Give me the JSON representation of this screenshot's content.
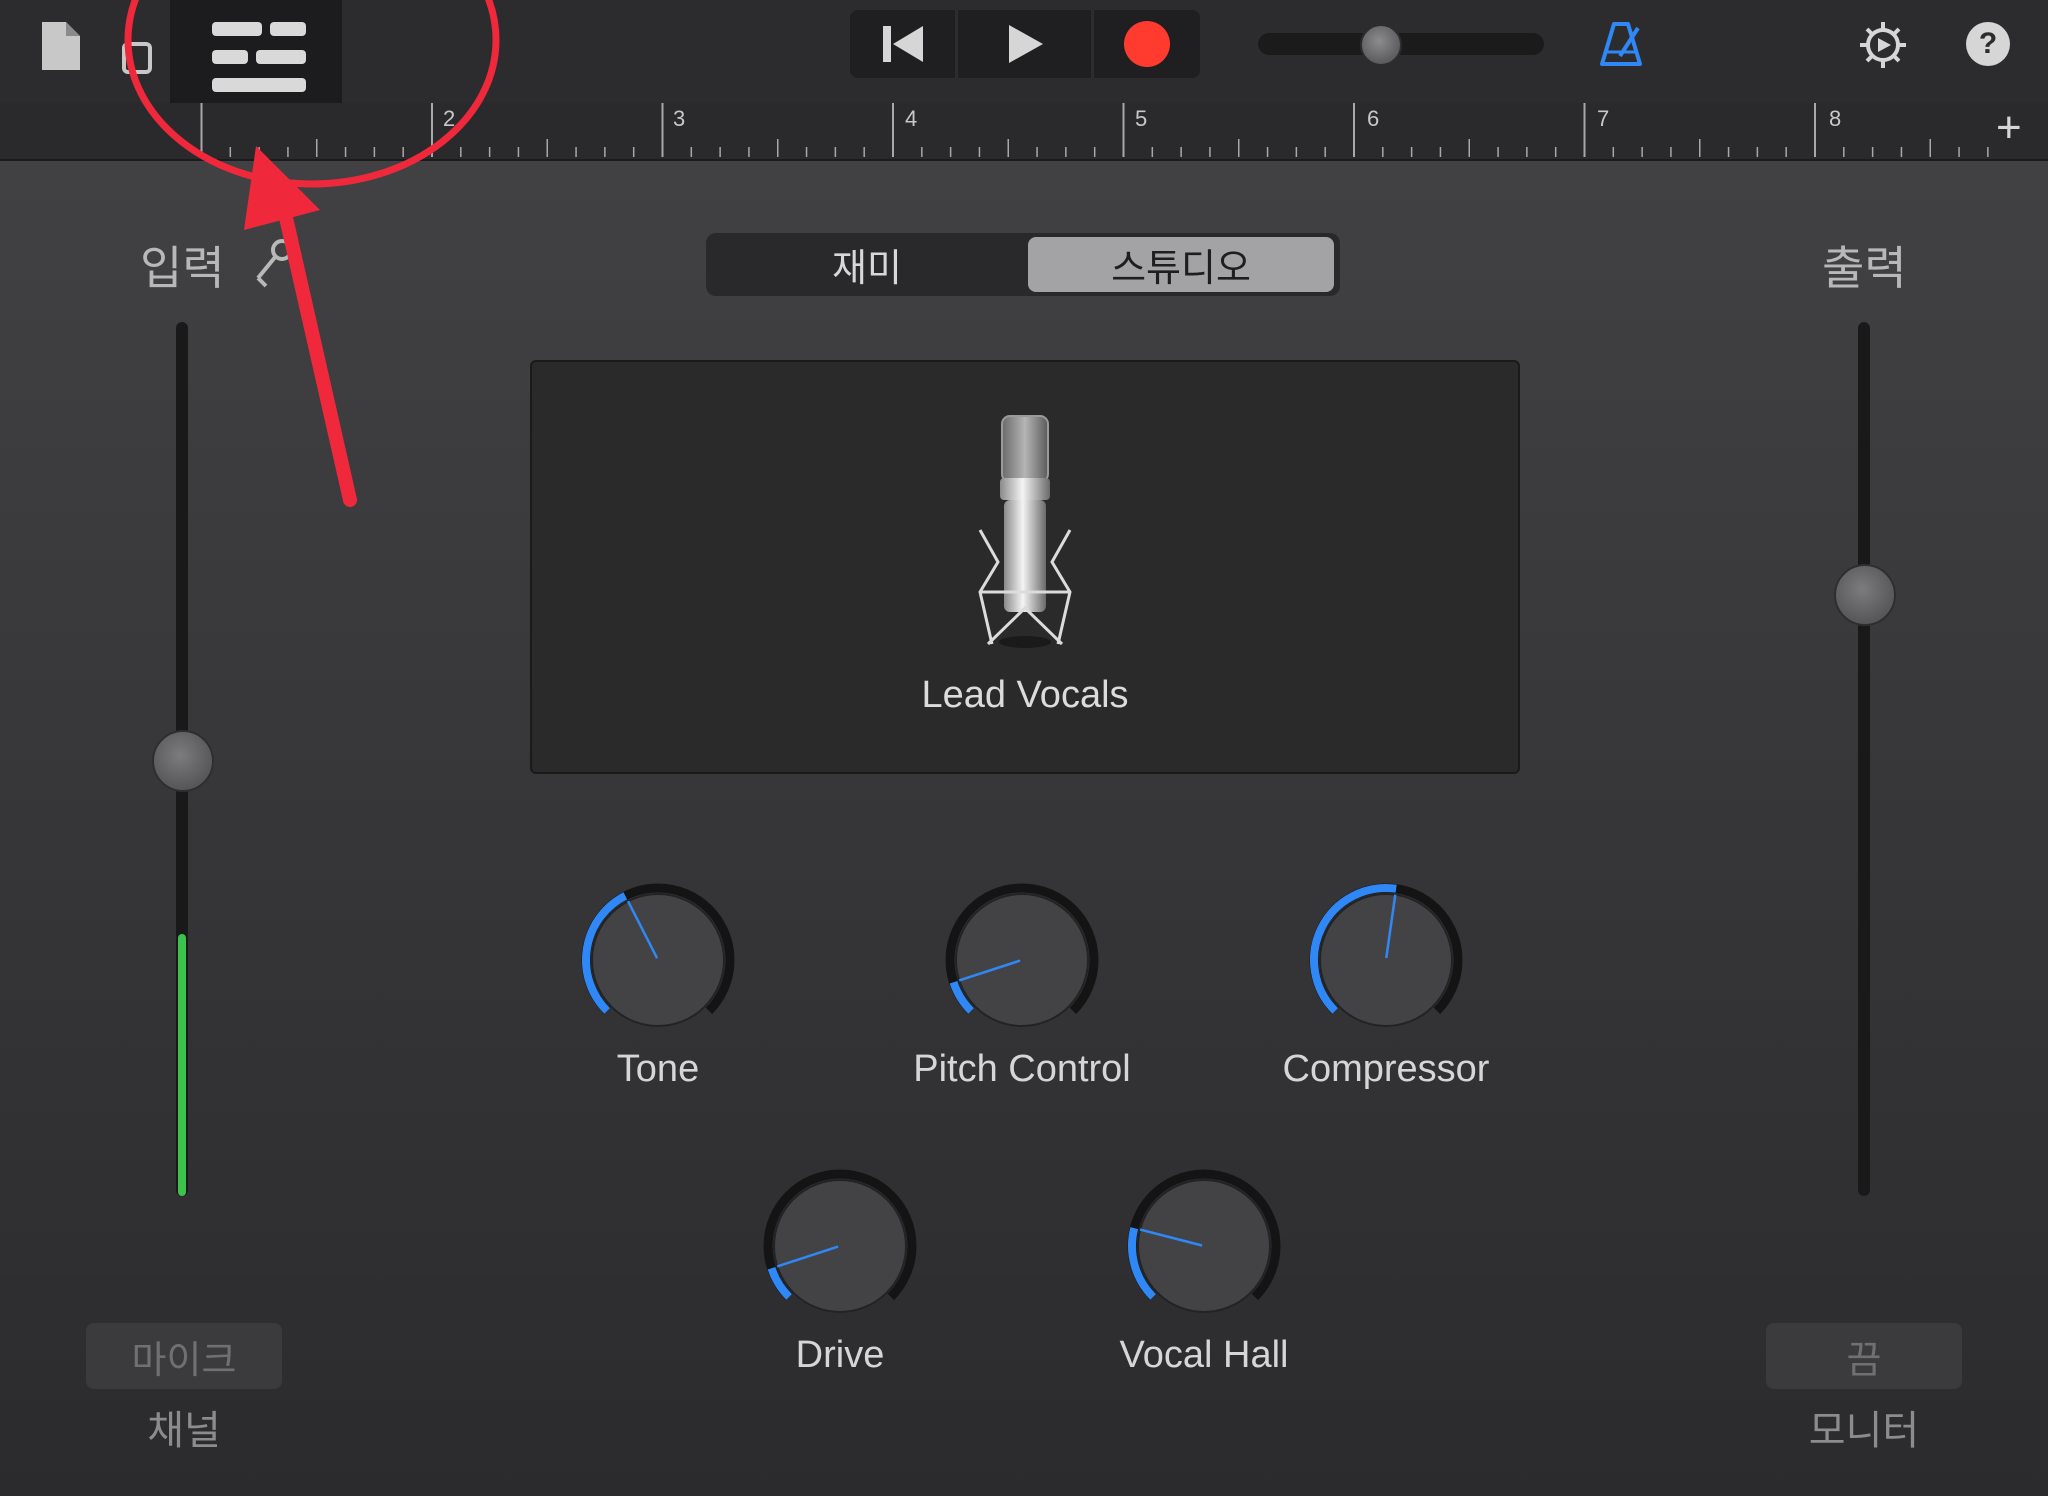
{
  "toolbar": {
    "ruler_numbers": [
      "2",
      "3",
      "4",
      "5",
      "6",
      "7",
      "8"
    ],
    "add_label": "+",
    "help_label": "?",
    "record_color": "#ff3b30",
    "accent_color": "#2f88f5",
    "master_volume": 0.42
  },
  "modes": {
    "fun_label": "재미",
    "studio_label": "스튜디오",
    "selected": "studio_label"
  },
  "input": {
    "title": "입력",
    "channel_button": "마이크",
    "channel_label": "채널",
    "level": 0.3,
    "gain": 0.5,
    "level_color": "#3ec24e"
  },
  "output": {
    "title": "출력",
    "monitor_button": "끔",
    "monitor_label": "모니터",
    "volume": 0.69
  },
  "patch": {
    "name": "Lead Vocals"
  },
  "knobs": [
    {
      "id": "tone",
      "label": "Tone",
      "value": 0.4
    },
    {
      "id": "pitch",
      "label": "Pitch Control",
      "value": 0.1
    },
    {
      "id": "compressor",
      "label": "Compressor",
      "value": 0.53
    },
    {
      "id": "drive",
      "label": "Drive",
      "value": 0.1
    },
    {
      "id": "vocal-hall",
      "label": "Vocal Hall",
      "value": 0.22
    }
  ],
  "annotation": {
    "color": "#f0283c"
  }
}
